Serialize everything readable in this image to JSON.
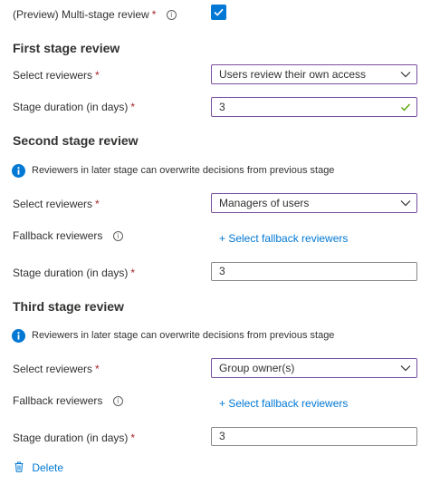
{
  "multistage": {
    "label": "(Preview) Multi-stage review",
    "required_mark": "*",
    "checked": true
  },
  "stages": [
    {
      "heading": "First stage review",
      "reviewers_label": "Select reviewers",
      "reviewers_value": "Users review their own access",
      "duration_label": "Stage duration (in days)",
      "duration_value": "3"
    },
    {
      "heading": "Second stage review",
      "info_text": "Reviewers in later stage can overwrite decisions from previous stage",
      "reviewers_label": "Select reviewers",
      "reviewers_value": "Managers of users",
      "fallback_label": "Fallback reviewers",
      "fallback_link": "+ Select fallback reviewers",
      "duration_label": "Stage duration (in days)",
      "duration_value": "3"
    },
    {
      "heading": "Third stage review",
      "info_text": "Reviewers in later stage can overwrite decisions from previous stage",
      "reviewers_label": "Select reviewers",
      "reviewers_value": "Group owner(s)",
      "fallback_label": "Fallback reviewers",
      "fallback_link": "+ Select fallback reviewers",
      "duration_label": "Stage duration (in days)",
      "duration_value": "3"
    }
  ],
  "required_mark": "*",
  "delete_label": "Delete",
  "colors": {
    "accent": "#0078d4",
    "focus_border": "#7a4fa0",
    "required": "#a4262c",
    "valid_check": "#57a300"
  },
  "icons": [
    "info-icon",
    "checkbox-checked-icon",
    "chevron-down-icon",
    "checkmark-icon",
    "info-filled-icon",
    "trash-icon"
  ]
}
